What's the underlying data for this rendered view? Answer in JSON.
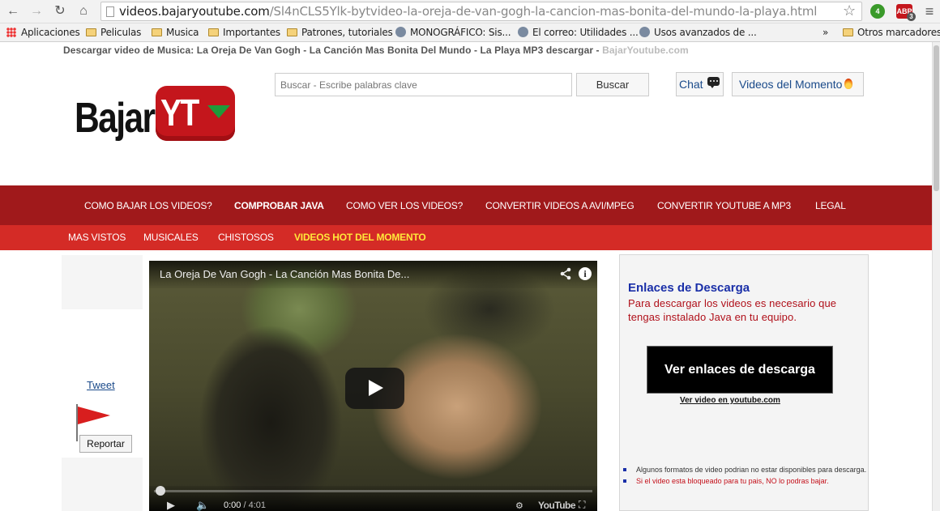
{
  "browser": {
    "url_host": "videos.bajaryoutube.com",
    "url_path": "/Sl4nCLS5Ylk-bytvideo-la-oreja-de-van-gogh-la-cancion-mas-bonita-del-mundo-la-playa.html",
    "ext_badge_1": "4",
    "ext_abp_label": "ABP",
    "ext_badge_2": "3",
    "bookmarks": [
      "Aplicaciones",
      "Peliculas",
      "Musica",
      "Importantes",
      "Patrones, tutoriales",
      "MONOGRÁFICO: Sis...",
      "El correo: Utilidades ...",
      "Usos avanzados de ..."
    ],
    "overflow": "»",
    "other_bookmarks": "Otros marcadores"
  },
  "page": {
    "topline": "Descargar video de Musica: La Oreja De Van Gogh - La Canción Mas Bonita Del Mundo - La Playa MP3 descargar -",
    "topline_brand": "BajarYoutube.com",
    "logo_text": "Bajar",
    "logo_yt": "YT",
    "search_placeholder": "Buscar - Escribe palabras clave",
    "search_button": "Buscar",
    "chat_label": "Chat",
    "videos_momento": "Videos del Momento"
  },
  "nav_primary": [
    "COMO BAJAR LOS VIDEOS?",
    "COMPROBAR JAVA",
    "COMO VER LOS VIDEOS?",
    "CONVERTIR VIDEOS A AVI/MPEG",
    "CONVERTIR YOUTUBE A MP3",
    "LEGAL"
  ],
  "nav_secondary": [
    "MAS VISTOS",
    "MUSICALES",
    "CHISTOSOS",
    "VIDEOS HOT DEL MOMENTO"
  ],
  "sidebar": {
    "tweet": "Tweet",
    "report": "Reportar"
  },
  "video": {
    "title": "La Oreja De Van Gogh - La Canción Mas Bonita De...",
    "current_time": "0:00",
    "duration": "/ 4:01",
    "youtube_label": "YouTube"
  },
  "download": {
    "title": "Enlaces de Descarga",
    "description": "Para descargar los videos es necesario que tengas instalado Java en tu equipo.",
    "button": "Ver enlaces de descarga",
    "youtube_link": "Ver video en youtube.com",
    "note1": "Algunos formatos de video podrian no estar disponibles para descarga.",
    "note2": "Si el video esta bloqueado para tu pais, NO lo podras bajar."
  },
  "colors": {
    "nav_primary_bg": "#a0191b",
    "nav_secondary_bg": "#d42b26",
    "nav_highlight": "#ffe83a",
    "link_blue": "#1a2fa8",
    "alert_red": "#b0101a"
  }
}
